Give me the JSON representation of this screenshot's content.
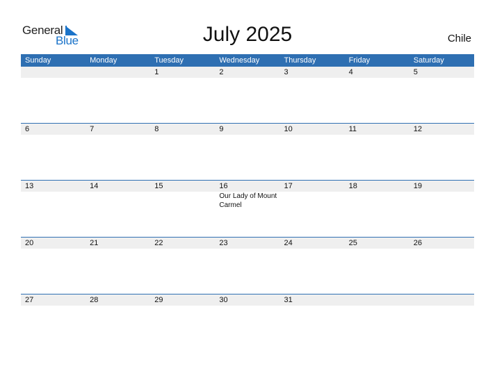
{
  "logo": {
    "general": "General",
    "blue": "Blue"
  },
  "title": "July 2025",
  "country": "Chile",
  "colors": {
    "header_bg": "#2e6fb2",
    "strip_bg": "#efefef",
    "logo_blue": "#1a73c9"
  },
  "weekdays": [
    "Sunday",
    "Monday",
    "Tuesday",
    "Wednesday",
    "Thursday",
    "Friday",
    "Saturday"
  ],
  "weeks": [
    {
      "days": [
        "",
        "",
        "1",
        "2",
        "3",
        "4",
        "5"
      ],
      "events": [
        "",
        "",
        "",
        "",
        "",
        "",
        ""
      ]
    },
    {
      "days": [
        "6",
        "7",
        "8",
        "9",
        "10",
        "11",
        "12"
      ],
      "events": [
        "",
        "",
        "",
        "",
        "",
        "",
        ""
      ]
    },
    {
      "days": [
        "13",
        "14",
        "15",
        "16",
        "17",
        "18",
        "19"
      ],
      "events": [
        "",
        "",
        "",
        "Our Lady of Mount Carmel",
        "",
        "",
        ""
      ]
    },
    {
      "days": [
        "20",
        "21",
        "22",
        "23",
        "24",
        "25",
        "26"
      ],
      "events": [
        "",
        "",
        "",
        "",
        "",
        "",
        ""
      ]
    },
    {
      "days": [
        "27",
        "28",
        "29",
        "30",
        "31",
        "",
        ""
      ],
      "events": [
        "",
        "",
        "",
        "",
        "",
        "",
        ""
      ]
    }
  ]
}
